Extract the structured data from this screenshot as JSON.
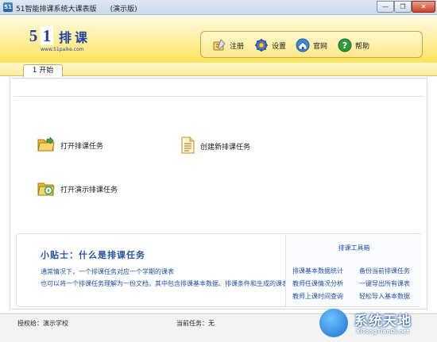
{
  "window": {
    "title": "51智能排课系统大课表版      (演示版)",
    "app_icon_text": "51",
    "minimize_label": "—",
    "maximize_label": "❐",
    "close_label": "✕"
  },
  "logo": {
    "digit_5": "5",
    "digit_1": "1",
    "name": "排课",
    "url": "www.51paike.com"
  },
  "toolbar": {
    "items": [
      {
        "label": "注册",
        "icon": "register-icon"
      },
      {
        "label": "设置",
        "icon": "gear-icon"
      },
      {
        "label": "官网",
        "icon": "home-icon"
      },
      {
        "label": "帮助",
        "icon": "help-icon"
      }
    ]
  },
  "tabs": [
    {
      "label": "1 开始"
    }
  ],
  "tasks": {
    "open": "打开排课任务",
    "create": "创建新排课任务",
    "open_demo": "打开演示排课任务"
  },
  "tips": {
    "title": "小贴士：什么是排课任务",
    "line1": "通常情况下，一个排课任务对应一个学期的课表",
    "line2": "也可以将一个排课任务理解为一份文档，其中包含排课基本数据、排课条件和生成的课表"
  },
  "toolbox": {
    "title": "排课工具箱",
    "links": [
      "排课基本数据统计",
      "备份当前排课任务",
      "教师任课情况分析",
      "一键导出所有课表",
      "教师上课时间查询",
      "轻松导入基本数据"
    ]
  },
  "status": {
    "license": "授权给：演示学校",
    "current_task": "当前任务：无"
  },
  "watermark": {
    "name": "系统天地",
    "url": "XiTongTianDi.net"
  },
  "colors": {
    "header_yellow": "#ffe45c",
    "link_blue": "#1f4fa8",
    "logo_blue": "#1d3fa6"
  }
}
